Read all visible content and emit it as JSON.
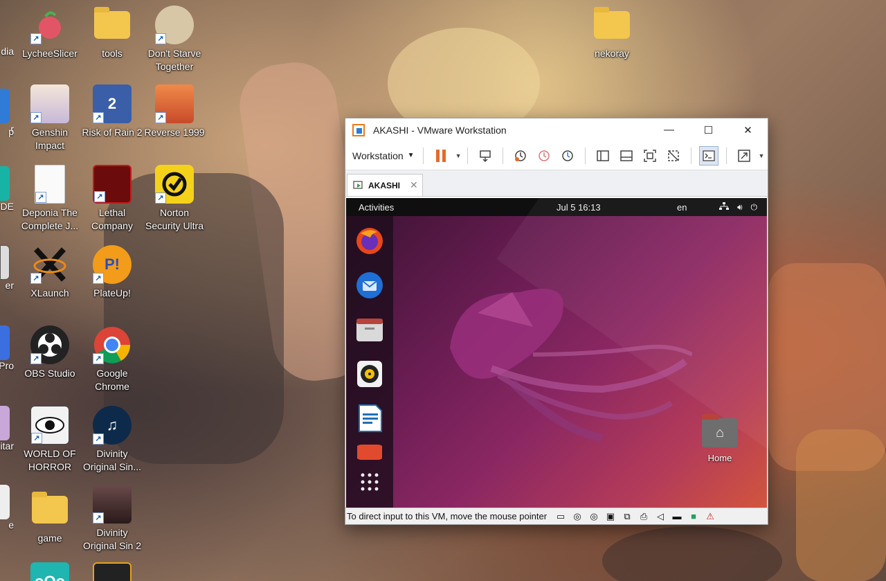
{
  "desktop": {
    "icons": [
      {
        "label": "LycheeSlicer"
      },
      {
        "label": "tools"
      },
      {
        "label": "Don't Starve Together"
      },
      {
        "label": "nekoray"
      },
      {
        "label": "Genshin Impact"
      },
      {
        "label": "Risk of Rain 2"
      },
      {
        "label": "Reverse 1999"
      },
      {
        "label": "Deponia The Complete J..."
      },
      {
        "label": "Lethal Company"
      },
      {
        "label": "Norton Security Ultra"
      },
      {
        "label": "XLaunch"
      },
      {
        "label": "PlateUp!"
      },
      {
        "label": "OBS Studio"
      },
      {
        "label": "Google Chrome"
      },
      {
        "label": "WORLD OF HORROR"
      },
      {
        "label": "Divinity Original Sin..."
      },
      {
        "label": "game"
      },
      {
        "label": "Divinity Original Sin 2"
      }
    ],
    "partial_labels": [
      "dia",
      "r",
      "p",
      "IDE",
      "er",
      "Pro",
      "itar",
      "e"
    ]
  },
  "vmware": {
    "title": "AKASHI - VMware Workstation",
    "menu_label": "Workstation",
    "tab_label": "AKASHI",
    "status_message": "To direct input to this VM, move the mouse pointer"
  },
  "ubuntu": {
    "activities": "Activities",
    "clock": "Jul 5  16:13",
    "lang": "en",
    "home_label": "Home"
  }
}
